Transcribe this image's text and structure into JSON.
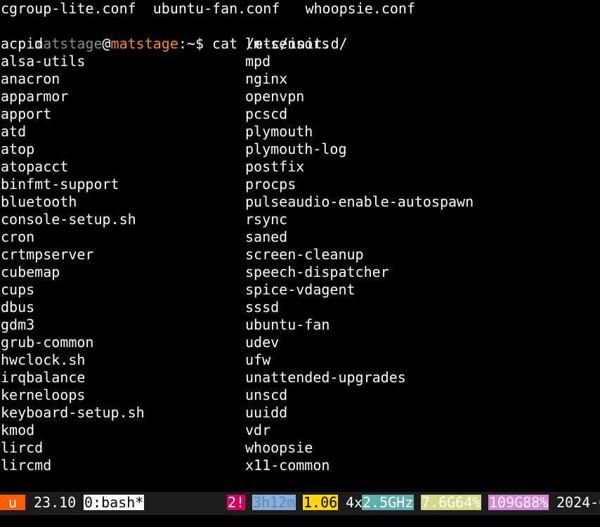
{
  "header_line": "cgroup-lite.conf  ubuntu-fan.conf   whoopsie.conf",
  "prompt": {
    "user": "matstage",
    "at": "@",
    "host": "matstage",
    "path": ":~$",
    "command": "cat /etc/init.d/"
  },
  "listing": [
    [
      "acpid",
      "lm-sensors"
    ],
    [
      "alsa-utils",
      "mpd"
    ],
    [
      "anacron",
      "nginx"
    ],
    [
      "apparmor",
      "openvpn"
    ],
    [
      "apport",
      "pcscd"
    ],
    [
      "atd",
      "plymouth"
    ],
    [
      "atop",
      "plymouth-log"
    ],
    [
      "atopacct",
      "postfix"
    ],
    [
      "binfmt-support",
      "procps"
    ],
    [
      "bluetooth",
      "pulseaudio-enable-autospawn"
    ],
    [
      "console-setup.sh",
      "rsync"
    ],
    [
      "cron",
      "saned"
    ],
    [
      "crtmpserver",
      "screen-cleanup"
    ],
    [
      "cubemap",
      "speech-dispatcher"
    ],
    [
      "cups",
      "spice-vdagent"
    ],
    [
      "dbus",
      "sssd"
    ],
    [
      "gdm3",
      "ubuntu-fan"
    ],
    [
      "grub-common",
      "udev"
    ],
    [
      "hwclock.sh",
      "ufw"
    ],
    [
      "irqbalance",
      "unattended-upgrades"
    ],
    [
      "kerneloops",
      "unscd"
    ],
    [
      "keyboard-setup.sh",
      "uuidd"
    ],
    [
      "kmod",
      "vdr"
    ],
    [
      "lircd",
      "whoopsie"
    ],
    [
      "lircmd",
      "x11-common"
    ]
  ],
  "statusbar": {
    "session": "u",
    "version": "23.10",
    "window": "0:bash*",
    "alert": "2!",
    "uptime": "3h12m",
    "load": "1.06",
    "cpu_count": "4x",
    "cpu_freq": "2.5GHz",
    "mem": "7.6G64%",
    "disk": "109G88%",
    "date": "2024-0"
  },
  "colors": {
    "background": "#000000",
    "text": "#ffffff",
    "prompt_user": "#8a8a8a",
    "prompt_host": "#ff8c00",
    "status_bg": "#1c1c1c",
    "session_bg": "#ff5f00",
    "window_bg": "#ffffff",
    "alert_bg": "#d7005f",
    "uptime_bg": "#87afd7",
    "uptime_fg": "#5f87af",
    "load_bg": "#ffd700",
    "cpu_freq_bg": "#5fafaf",
    "mem_bg": "#d7d787",
    "disk_bg": "#d787d7"
  }
}
